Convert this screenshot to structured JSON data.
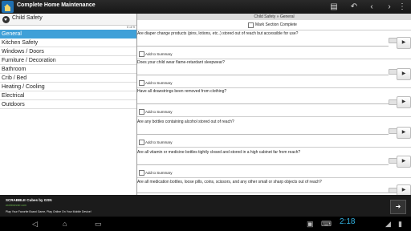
{
  "app": {
    "title": "Complete Home Maintenance"
  },
  "actionbar": {
    "icons": [
      "edit-icon",
      "undo-icon",
      "back-icon",
      "forward-icon",
      "menu-icon"
    ],
    "glyphs": [
      "▤",
      "↶",
      "‹",
      "›",
      "⋮"
    ]
  },
  "sidebar": {
    "section": "Child Safety",
    "count": "0 of 9",
    "items": [
      {
        "label": "General",
        "selected": true
      },
      {
        "label": "Kitchen Safety"
      },
      {
        "label": "Windows / Doors"
      },
      {
        "label": "Furniture / Decoration"
      },
      {
        "label": "Bathroom"
      },
      {
        "label": "Crib / Bed"
      },
      {
        "label": "Heating / Cooling"
      },
      {
        "label": "Electrical"
      },
      {
        "label": "Outdoors"
      }
    ]
  },
  "main": {
    "breadcrumb": "Child Safety » General",
    "mark_complete": "Mark Section Complete",
    "add_label": "Add to Summary",
    "go_glyph": "▶",
    "questions": [
      "Are diaper change products (pins, lotions, etc..) stored out of reach but accessible for use?",
      "Does your child wear flame-retardant sleepwear?",
      "Have all drawstrings been removed from clothing?",
      "Are any bottles containing alcohol stored out of reach?",
      "Are all vitamin or medicine bottles tightly closed and stored in a high cabinet far from reach?",
      "Are all medication bottles, loose pills, coins, scissors, and any other small or sharp objects out of reach?"
    ]
  },
  "ad": {
    "title": "SCRABBLE Cubes by GSN",
    "url": "worldwinner.com",
    "description": "Play Your Favorite Board Game, Play Online On Your Mobile Device!",
    "arrow": "➜"
  },
  "navbar": {
    "time": "2:18",
    "glyphs": {
      "back": "◁",
      "home": "⌂",
      "recents": "▭",
      "gallery": "▣",
      "keyboard": "⌨",
      "wifi": "◢",
      "battery": "▮"
    }
  },
  "colors": {
    "selected": "#3fa0d8",
    "clock": "#33b5e5",
    "ad_url": "#6ab04c"
  }
}
